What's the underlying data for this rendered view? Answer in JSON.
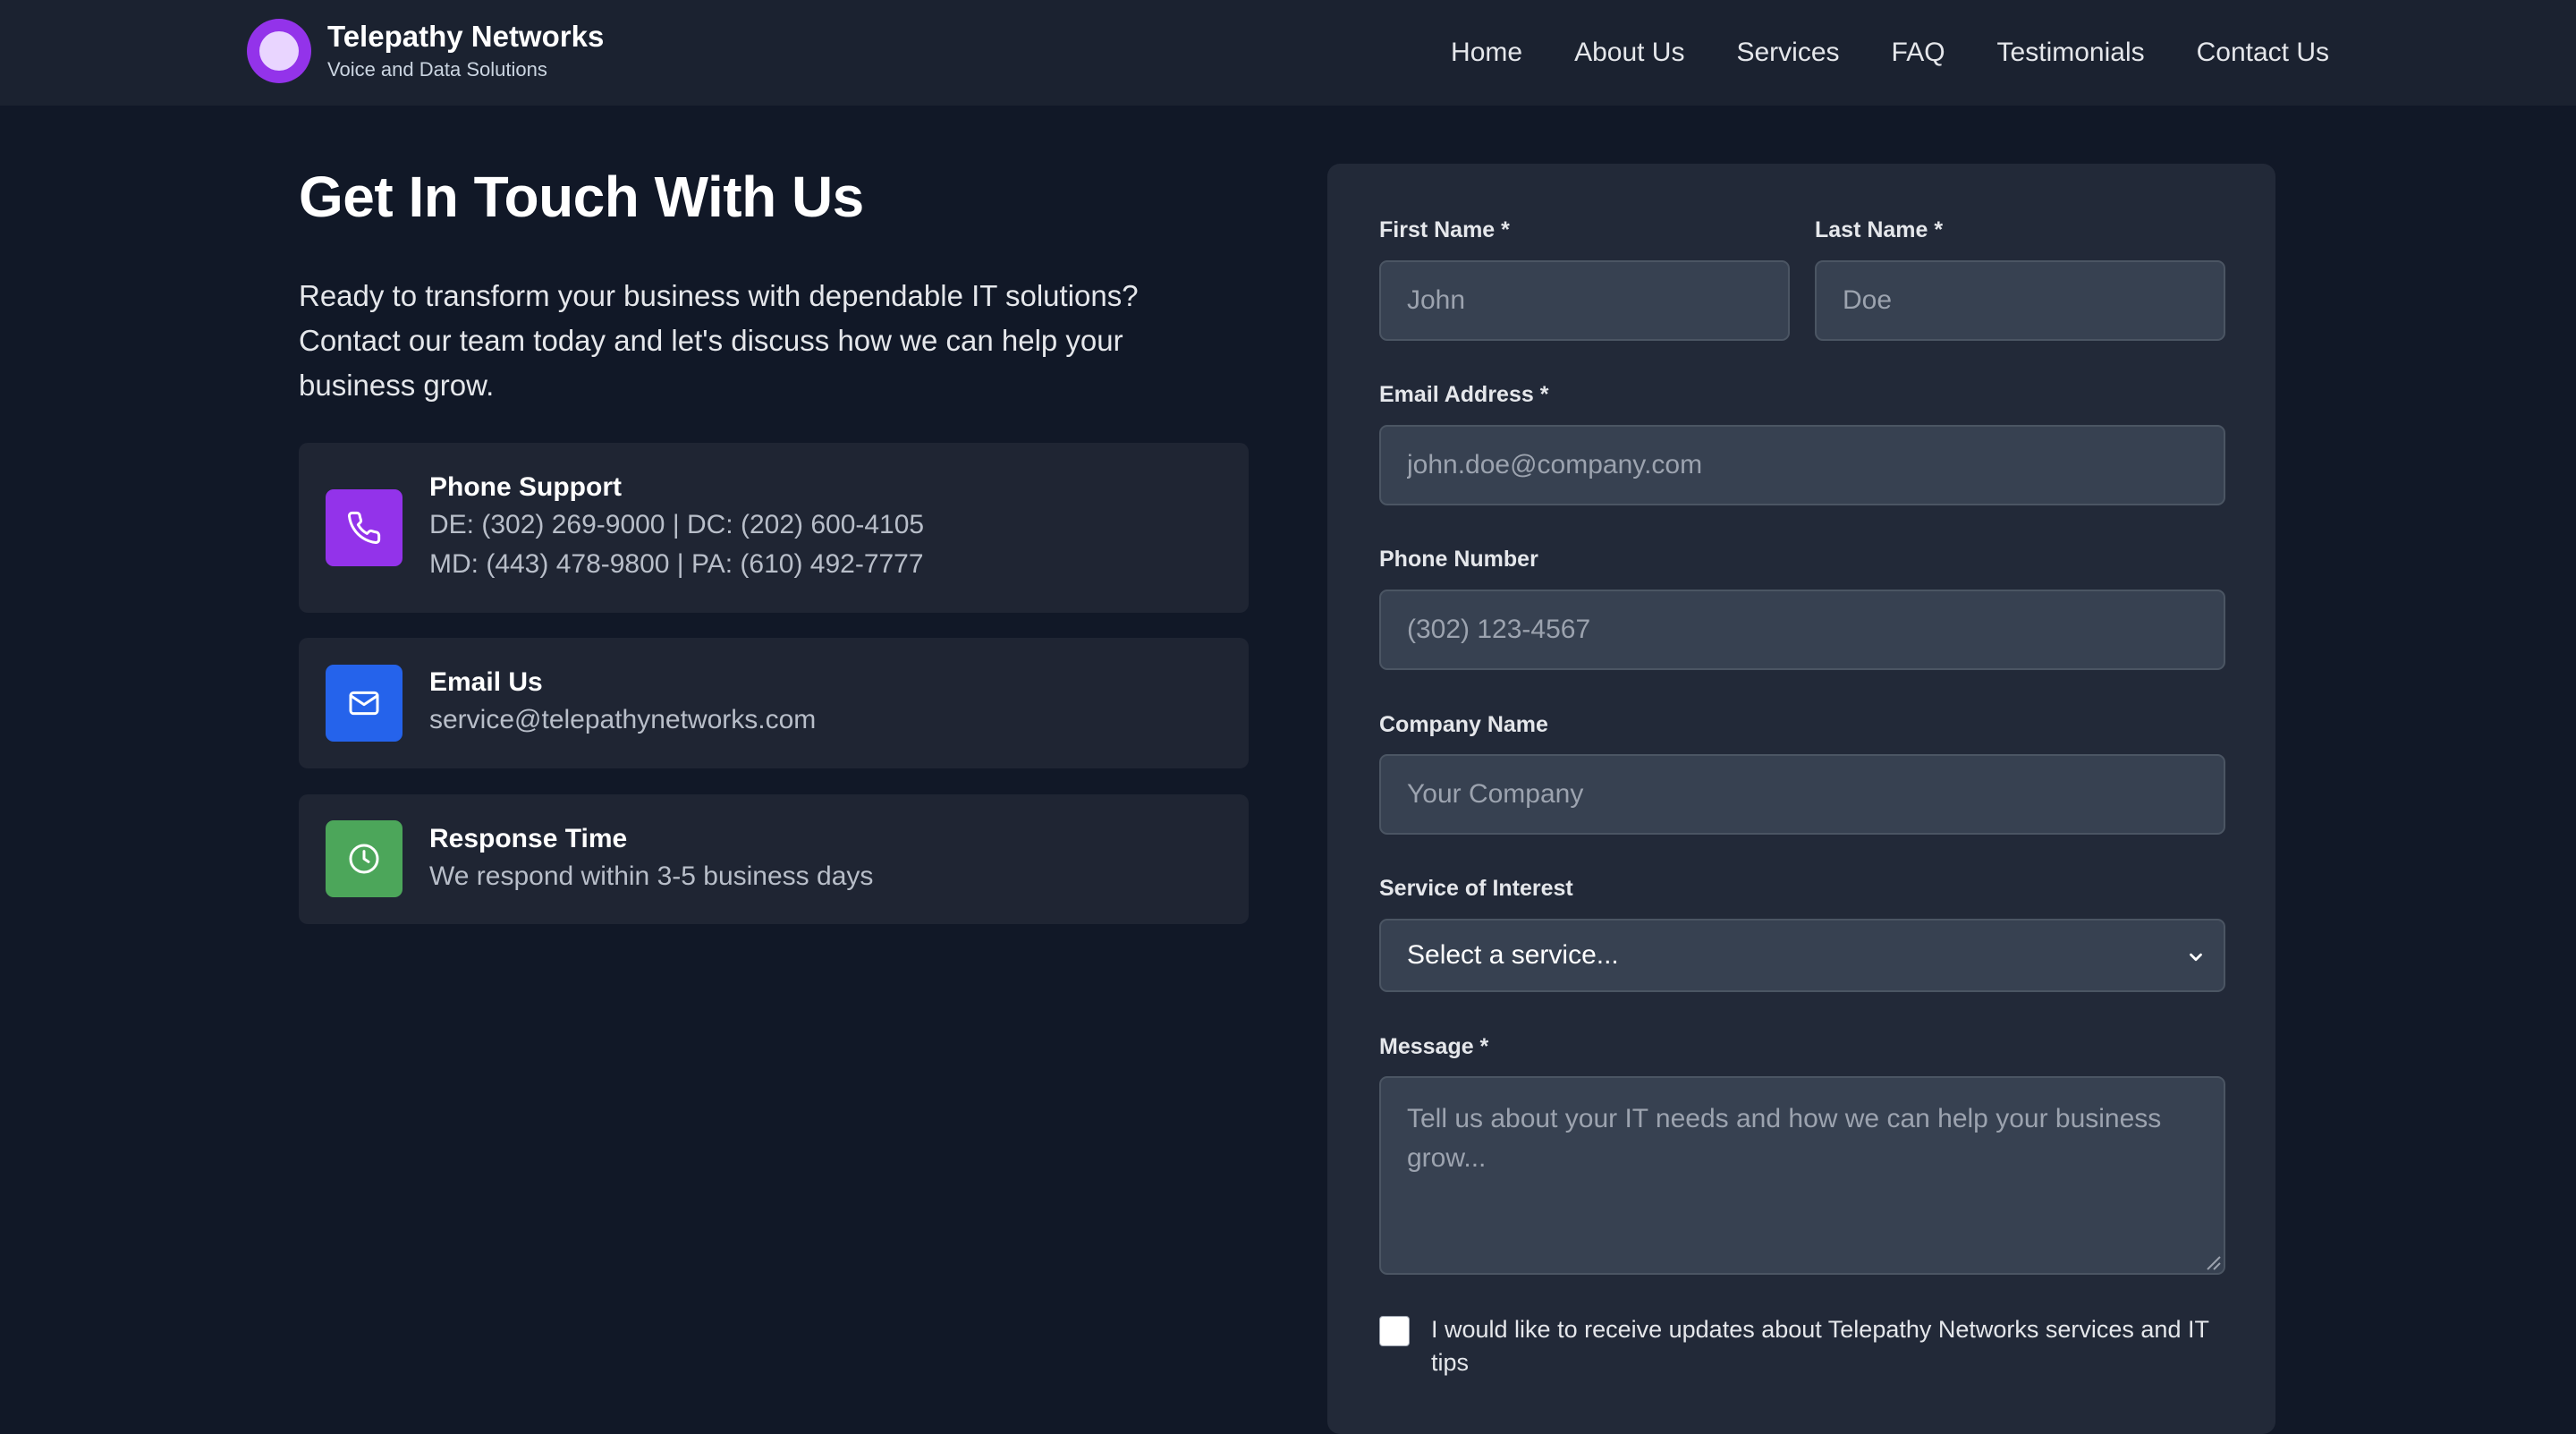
{
  "header": {
    "brand_name": "Telepathy Networks",
    "brand_tagline": "Voice and Data Solutions",
    "nav": [
      "Home",
      "About Us",
      "Services",
      "FAQ",
      "Testimonials",
      "Contact Us"
    ]
  },
  "intro": {
    "title": "Get In Touch With Us",
    "text": "Ready to transform your business with dependable IT solutions? Contact our team today and let's discuss how we can help your business grow."
  },
  "contact_cards": [
    {
      "icon": "phone-icon",
      "color": "#9333ea",
      "title": "Phone Support",
      "lines": [
        "DE: (302) 269-9000 | DC: (202) 600-4105",
        "MD: (443) 478-9800 | PA: (610) 492-7777"
      ]
    },
    {
      "icon": "mail-icon",
      "color": "#2563eb",
      "title": "Email Us",
      "lines": [
        "service@telepathynetworks.com"
      ]
    },
    {
      "icon": "clock-icon",
      "color": "#4ca65a",
      "title": "Response Time",
      "lines": [
        "We respond within 3-5 business days"
      ]
    }
  ],
  "form": {
    "first_name": {
      "label": "First Name *",
      "placeholder": "John"
    },
    "last_name": {
      "label": "Last Name *",
      "placeholder": "Doe"
    },
    "email": {
      "label": "Email Address *",
      "placeholder": "john.doe@company.com"
    },
    "phone": {
      "label": "Phone Number",
      "placeholder": "(302) 123-4567"
    },
    "company": {
      "label": "Company Name",
      "placeholder": "Your Company"
    },
    "service": {
      "label": "Service of Interest",
      "selected": "Select a service..."
    },
    "message": {
      "label": "Message *",
      "placeholder": "Tell us about your IT needs and how we can help your business grow..."
    },
    "updates_checkbox": {
      "checked": false,
      "label": "I would like to receive updates about Telepathy Networks services and IT tips"
    }
  }
}
